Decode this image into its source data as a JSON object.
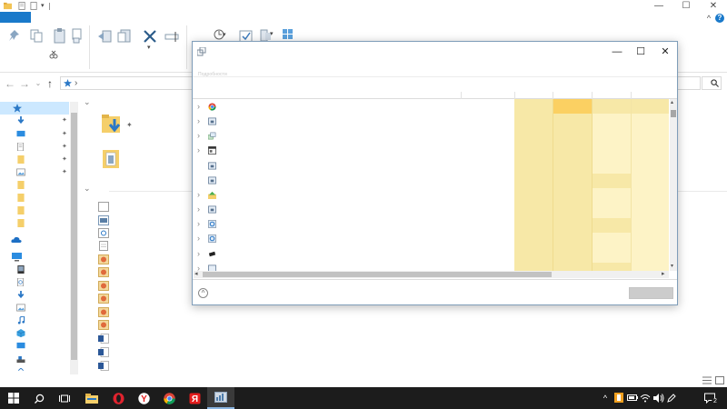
{
  "colors": {
    "accent": "#1979ca",
    "taskbar": "#1c1c1c",
    "selection": "#cce8ff",
    "column_highlight": "#f7e8a7",
    "column_highlight_strong": "#fbd062",
    "column_light": "#fdf3c6"
  },
  "window_controls": {
    "minimize": "—",
    "maximize": "☐",
    "close": "✕"
  },
  "ribbon": {
    "help": "?",
    "collapse": "^"
  },
  "address_bar": {
    "breadcrumb_separator": "›"
  },
  "icons": {
    "quick_access": [
      "save-icon",
      "properties-icon",
      "undo-icon"
    ],
    "ribbon": [
      "pin-icon",
      "copy-icon",
      "paste-icon",
      "cut-icon",
      "move-to-icon",
      "copy-to-icon",
      "delete-icon",
      "rename-icon",
      "new-folder-icon",
      "properties-icon",
      "select-all-icon",
      "select-none-icon",
      "invert-selection-icon"
    ],
    "nav_pane": [
      "quick-access-star-icon",
      "downloads-icon",
      "desktop-icon",
      "documents-icon",
      "folder-icon",
      "pictures-icon",
      "folder-icon",
      "folder-icon",
      "folder-icon",
      "folder-icon",
      "onedrive-icon",
      "this-pc-icon",
      "device-icon",
      "documents-icon",
      "downloads-icon",
      "pictures-icon",
      "music-icon",
      "3d-objects-icon",
      "desktop-icon",
      "local-disk-icon",
      "network-icon"
    ],
    "dialog_rows": [
      "chrome-icon",
      "application-icon",
      "process-group-icon",
      "window-icon",
      "application-icon",
      "application-icon",
      "home-folder-icon",
      "application-icon",
      "settings-icon",
      "settings-icon",
      "device-icon",
      "application-icon"
    ],
    "taskbar": [
      "windows-start-icon",
      "search-icon",
      "task-view-icon",
      "file-explorer-icon",
      "opera-icon",
      "yandex-icon",
      "chrome-icon",
      "yandex-browser-icon",
      "task-manager-icon"
    ],
    "tray": [
      "show-hidden-icons-chevron",
      "app-tray-icon",
      "battery-icon",
      "network-icon",
      "volume-icon",
      "wifi-icon",
      "pen-icon",
      "notifications-icon"
    ]
  },
  "tray": {
    "chevron": "^",
    "notification_count": "2"
  },
  "dialog": {
    "tab_caption": "Подробности",
    "expand_symbol": "^"
  }
}
